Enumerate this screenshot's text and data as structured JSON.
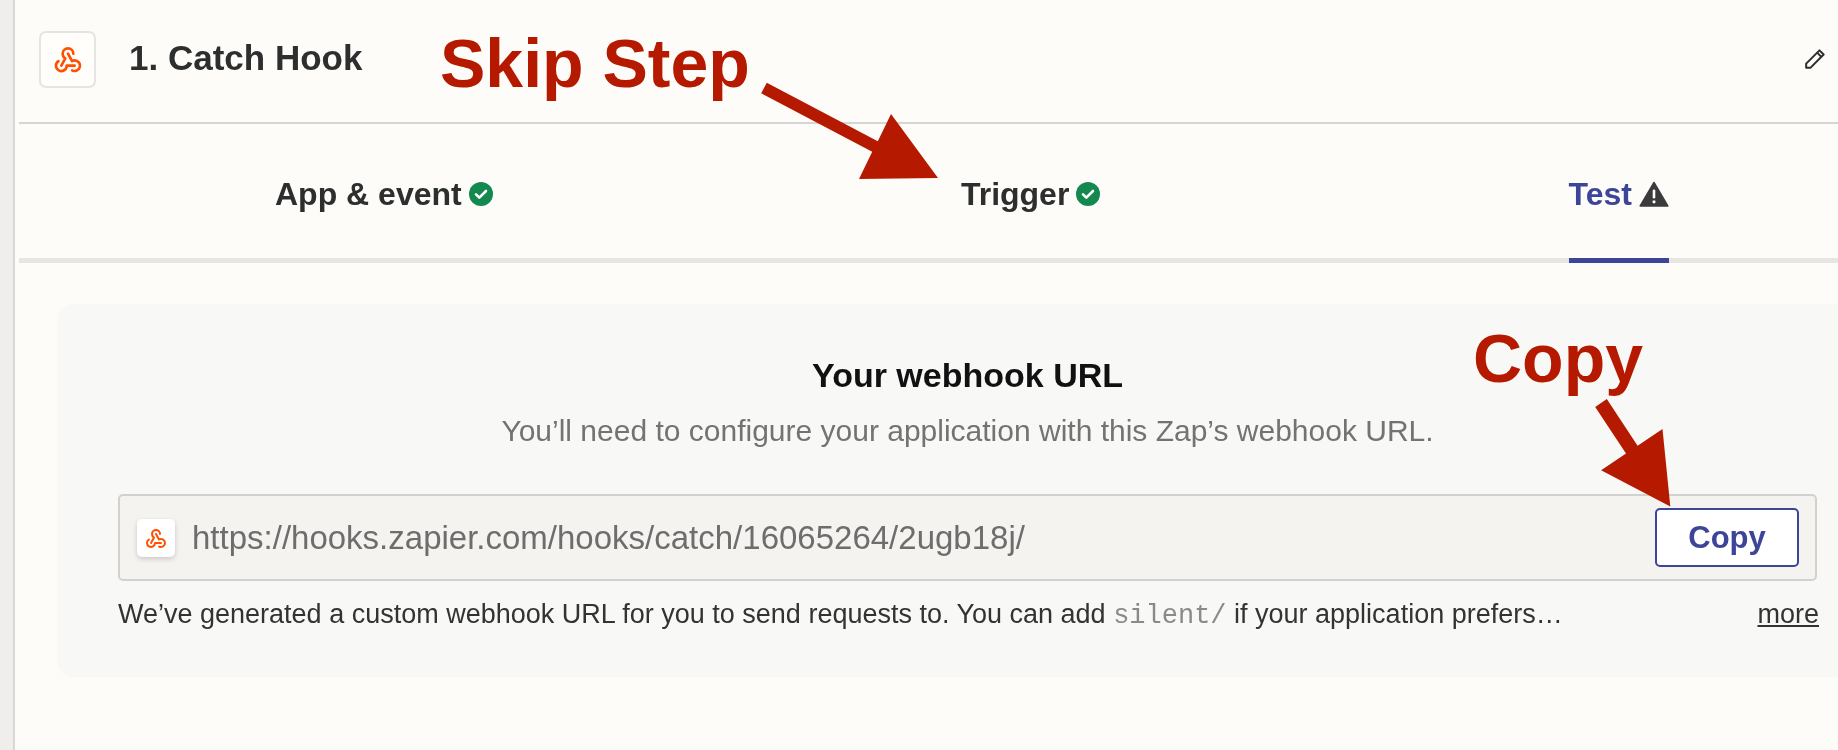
{
  "step": {
    "title": "1. Catch Hook"
  },
  "tabs": [
    {
      "label": "App & event",
      "selected": false,
      "kind": "complete"
    },
    {
      "label": "Trigger",
      "selected": false,
      "kind": "complete"
    },
    {
      "label": "Test",
      "selected": true,
      "kind": "warning"
    }
  ],
  "webhook": {
    "heading": "Your webhook URL",
    "description": "You’ll need to configure your application with this Zap’s webhook URL.",
    "url": "https://hooks.zapier.com/hooks/catch/16065264/2ugb18j/",
    "copy_button": "Copy",
    "note": [
      {
        "kind": "text",
        "text": "We’ve generated a custom webhook URL for you to send requests to. You can add "
      },
      {
        "kind": "code",
        "text": "silent/"
      },
      {
        "kind": "text",
        "text": " if your application prefers…"
      }
    ],
    "more_link": "more"
  },
  "annotations": [
    {
      "text": "Skip Step"
    },
    {
      "text": "Copy"
    }
  ]
}
